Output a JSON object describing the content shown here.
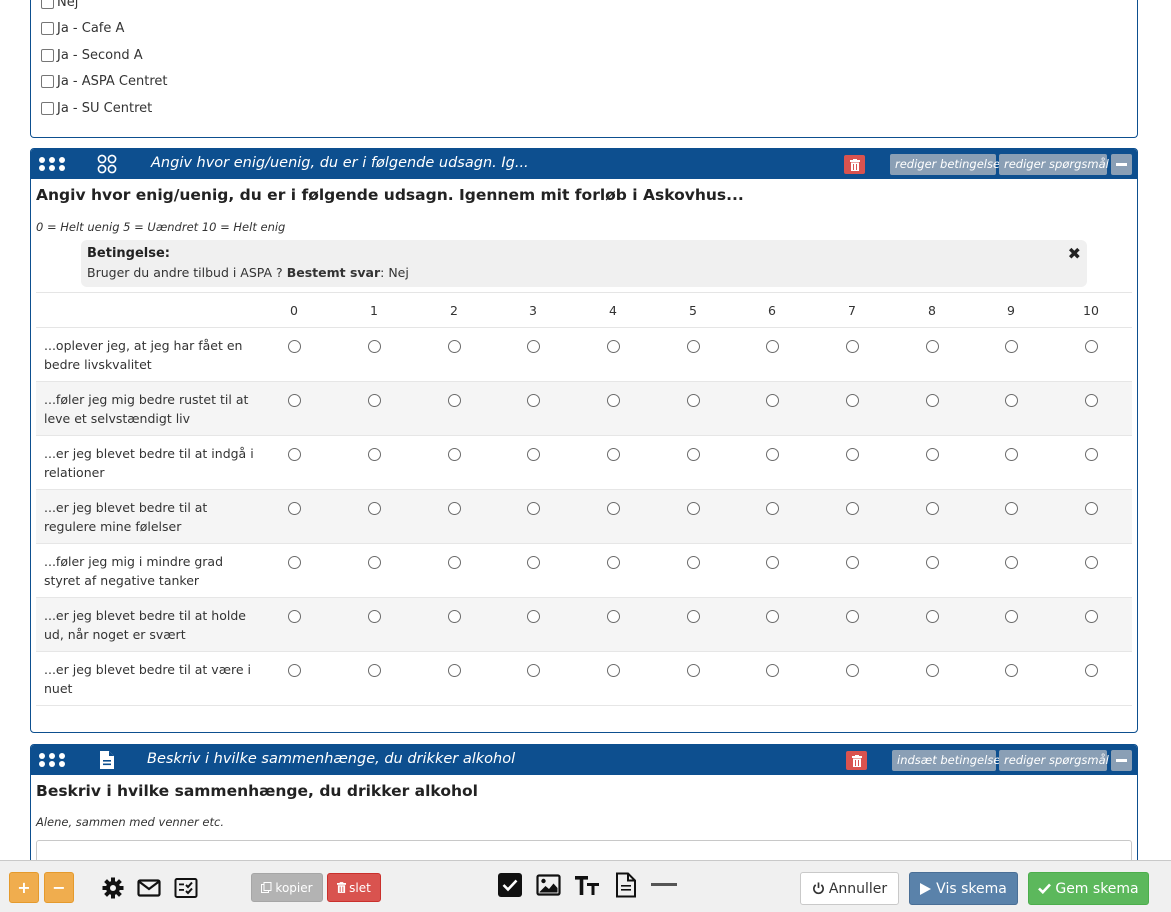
{
  "top_options": [
    "Nej",
    "Ja - Cafe A",
    "Ja - Second A",
    "Ja - ASPA Centret",
    "Ja - SU Centret"
  ],
  "q1": {
    "header_title": "Angiv hvor enig/uenig, du er i følgende udsagn. Ig...",
    "btn_condition": "rediger betingelse",
    "btn_question": "rediger spørgsmål",
    "text": "Angiv hvor enig/uenig, du er i følgende udsagn. Igennem mit forløb i Askovhus...",
    "help": "0 = Helt uenig 5 = Uændret 10 = Helt enig",
    "condition": {
      "title": "Betingelse:",
      "question": "Bruger du andre tilbud i ASPA ?",
      "answer_label": "Bestemt svar",
      "answer_value": ": Nej",
      "close": "✖"
    },
    "scale": [
      "0",
      "1",
      "2",
      "3",
      "4",
      "5",
      "6",
      "7",
      "8",
      "9",
      "10"
    ],
    "rows": [
      "...oplever jeg, at jeg har fået en bedre livskvalitet",
      "...føler jeg mig bedre rustet til at leve et selvstændigt liv",
      "...er jeg blevet bedre til at indgå i relationer",
      "...er jeg blevet bedre til at regulere mine følelser",
      "...føler jeg mig i mindre grad styret af negative tanker",
      "...er jeg blevet bedre til at holde ud, når noget er svært",
      "...er jeg blevet bedre til at være i nuet"
    ]
  },
  "q2": {
    "header_title": "Beskriv i hvilke sammenhænge, du drikker alkohol",
    "btn_condition": "indsæt betingelse",
    "btn_question": "rediger spørgsmål",
    "text": "Beskriv i hvilke sammenhænge, du drikker alkohol",
    "help": "Alene, sammen med venner etc."
  },
  "toolbar": {
    "add": "+",
    "remove": "−",
    "copy": "kopier",
    "delete": "slet",
    "cancel": "Annuller",
    "preview": "Vis skema",
    "save": "Gem skema",
    "icons": [
      "gear-icon",
      "mail-icon",
      "checklist-icon",
      "checkbox-icon",
      "image-icon",
      "text-size-icon",
      "document-icon",
      "divider-icon"
    ]
  },
  "colors": {
    "header_blue": "#0d4f8f",
    "danger": "#d9534f",
    "header_button": "#8a9fb5",
    "warning": "#f0ad4e",
    "primary": "#5a82aa",
    "success": "#5cb85c"
  }
}
